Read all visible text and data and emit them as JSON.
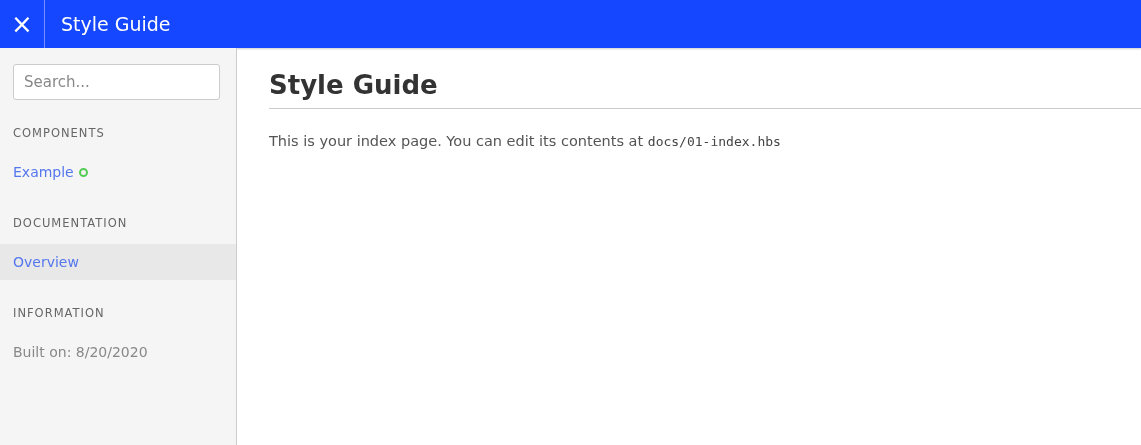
{
  "header": {
    "close_icon": "×",
    "title": "Style Guide"
  },
  "sidebar": {
    "search": {
      "placeholder": "Search..."
    },
    "sections": [
      {
        "title": "COMPONENTS",
        "items": [
          {
            "kind": "link",
            "label": "Example",
            "selected": false,
            "color": "#55cc55"
          }
        ]
      },
      {
        "title": "DOCUMENTATION",
        "items": [
          {
            "kind": "link",
            "label": "Overview",
            "selected": true
          }
        ]
      },
      {
        "title": "INFORMATION",
        "items": [
          {
            "kind": "text",
            "label": "Built on: 8/20/2020"
          }
        ]
      }
    ]
  },
  "main": {
    "title": "Style Guide",
    "paragraph": {
      "text": "This is your index page. You can edit its contents at ",
      "code": "docs/01-index.hbs"
    }
  }
}
